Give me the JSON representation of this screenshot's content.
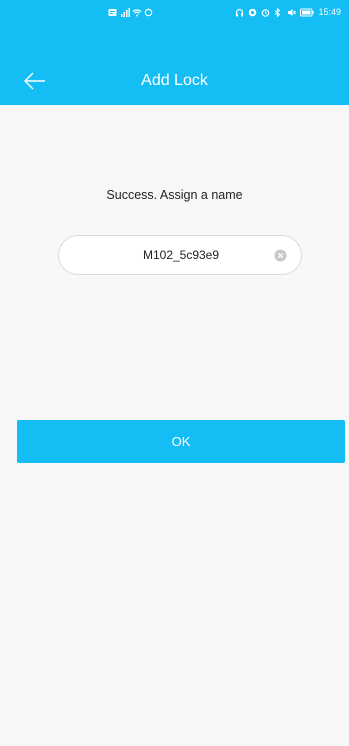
{
  "status_bar": {
    "time": "15:49",
    "left_icons": [
      "notification-icon",
      "signal-icon",
      "wifi-icon",
      "sync-icon"
    ],
    "right_icons": [
      "headset-icon",
      "eye-icon",
      "alarm-icon",
      "bluetooth-icon",
      "mute-icon",
      "battery-icon"
    ]
  },
  "header": {
    "title": "Add Lock",
    "back_icon": "arrow-left-icon"
  },
  "main": {
    "prompt": "Success. Assign a name",
    "name_value": "M102_5c93e9",
    "clear_icon": "clear-icon",
    "ok_label": "OK"
  },
  "colors": {
    "accent": "#14bdf4",
    "background": "#f7f7f7",
    "field_background": "#ffffff"
  }
}
